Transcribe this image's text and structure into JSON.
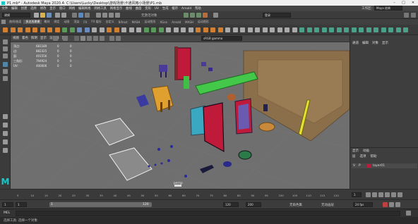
{
  "window": {
    "title": "P1.mb* - Autodesk Maya 2020.4: C:\\Users\\Lucky\\Desktop\\游戏场景\\卡通风格小场景\\P1.mb"
  },
  "menubar": {
    "items": [
      "文件",
      "编辑",
      "创建",
      "选择",
      "修改",
      "显示",
      "窗口",
      "网格",
      "编辑网格",
      "网格工具",
      "网格显示",
      "曲线",
      "曲面",
      "变形",
      "UV",
      "生成",
      "缓存",
      "Arnold",
      "帮助"
    ],
    "workspace_label": "工作区:",
    "workspace_value": "Maya 经典"
  },
  "statusline": {
    "mode_value": "建模",
    "symmetry_label": "无激活对象",
    "live_label": "登录"
  },
  "shelf": {
    "tabs": [
      "曲线/曲面",
      "多边形建模",
      "雕刻",
      "绑定",
      "动画",
      "渲染",
      "FX",
      "FX 缓存",
      "自定义",
      "Bifrost",
      "MASH",
      "运动图形",
      "XGen",
      "Arnold",
      "MASH",
      "运动图形"
    ],
    "active_tab_index": 1
  },
  "viewport": {
    "menu_items": [
      "视图",
      "着色",
      "照明",
      "显示",
      "渲染器",
      "面板"
    ],
    "camera_name": "persp",
    "hud": {
      "rows": [
        {
          "label": "顶点:",
          "v1": "681189",
          "v2": "0",
          "v3": "0"
        },
        {
          "label": "边:",
          "v1": "882325",
          "v2": "0",
          "v3": "0"
        },
        {
          "label": "面:",
          "v1": "401556",
          "v2": "0",
          "v3": "0"
        },
        {
          "label": "三角形:",
          "v1": "794924",
          "v2": "0",
          "v3": "0"
        },
        {
          "label": "UV:",
          "v1": "400006",
          "v2": "0",
          "v3": "0"
        }
      ]
    },
    "colorspace_value": "sRGB gamma"
  },
  "channel_box": {
    "tabs": [
      "通道",
      "编辑",
      "对象",
      "显示"
    ]
  },
  "layer_panel": {
    "tabs": [
      "显示",
      "动画"
    ],
    "menu": [
      "层",
      "选项",
      "帮助"
    ],
    "layer_v": "V",
    "layer_p": "P",
    "layer_name": "layer01"
  },
  "timeslider": {
    "ticks": [
      "5",
      "10",
      "15",
      "20",
      "25",
      "30",
      "35",
      "40",
      "45",
      "50",
      "55",
      "60",
      "65",
      "70",
      "75",
      "80",
      "85",
      "90",
      "95",
      "100",
      "105",
      "110",
      "115",
      "120"
    ],
    "current_frame": "1"
  },
  "rangebar": {
    "start": "1",
    "range_start": "1",
    "range_end": "120",
    "end_a": "120",
    "end_b": "200",
    "char_set": "无角色集",
    "anim_layer": "无动画层",
    "fps": "24 fps"
  },
  "cmdline": {
    "lang": "MEL"
  },
  "helpline": {
    "text": "选择工具: 选择一个对象"
  },
  "colors": {
    "viewport_bg": "#6f6f6f",
    "maya_logo": "#19c9c9",
    "accent": "#5285a6"
  }
}
